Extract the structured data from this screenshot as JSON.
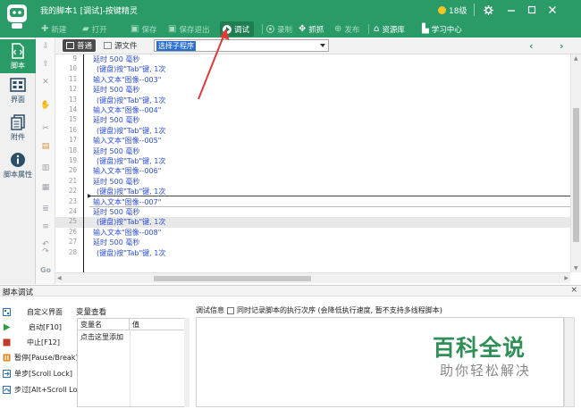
{
  "titlebar": {
    "title": "我的脚本1 [调试]-按键精灵",
    "vip_label": "18级"
  },
  "toolbar": {
    "tools": [
      {
        "label": "新建",
        "icon": "plus-icon",
        "enabled": false
      },
      {
        "label": "打开",
        "icon": "folder-open-icon",
        "enabled": false
      },
      {
        "label": "保存",
        "icon": "save-icon",
        "enabled": false
      },
      {
        "label": "保存退出",
        "icon": "save-exit-icon",
        "enabled": false
      },
      {
        "label": "调试",
        "icon": "play-icon",
        "enabled": true,
        "active": true
      },
      {
        "label": "录制",
        "icon": "record-icon",
        "enabled": false
      },
      {
        "label": "抓抓",
        "icon": "grab-icon",
        "enabled": true
      },
      {
        "label": "发布",
        "icon": "publish-icon",
        "enabled": false
      },
      {
        "label": "资源库",
        "icon": "resource-library-icon",
        "enabled": true
      },
      {
        "label": "学习中心",
        "icon": "learning-center-icon",
        "enabled": true
      }
    ]
  },
  "leftnav": {
    "items": [
      {
        "label": "脚本",
        "icon": "script-icon",
        "active": true
      },
      {
        "label": "界面",
        "icon": "interface-icon",
        "active": false
      },
      {
        "label": "附件",
        "icon": "attachment-icon",
        "active": false
      },
      {
        "label": "脚本属性",
        "icon": "info-icon",
        "active": false
      }
    ]
  },
  "editor": {
    "view_normal": "普通",
    "view_source": "源文件",
    "subroutine_select": "选择子程序",
    "lines": [
      {
        "n": "9",
        "text": "延时 500 毫秒",
        "indent": false
      },
      {
        "n": "10",
        "text": "(键盘)按\"Tab\"键, 1次",
        "indent": true
      },
      {
        "n": "11",
        "text": "输入文本\"图像--003\"",
        "indent": false
      },
      {
        "n": "12",
        "text": "延时 500 毫秒",
        "indent": false
      },
      {
        "n": "13",
        "text": "(键盘)按\"Tab\"键, 1次",
        "indent": true
      },
      {
        "n": "14",
        "text": "输入文本\"图像--004\"",
        "indent": false
      },
      {
        "n": "15",
        "text": "延时 500 毫秒",
        "indent": false
      },
      {
        "n": "16",
        "text": "(键盘)按\"Tab\"键, 1次",
        "indent": true
      },
      {
        "n": "17",
        "text": "输入文本\"图像--005\"",
        "indent": false
      },
      {
        "n": "18",
        "text": "延时 500 毫秒",
        "indent": false
      },
      {
        "n": "19",
        "text": "(键盘)按\"Tab\"键, 1次",
        "indent": true
      },
      {
        "n": "20",
        "text": "输入文本\"图像--006\"",
        "indent": false
      },
      {
        "n": "21",
        "text": "延时 500 毫秒",
        "indent": false
      },
      {
        "n": "22",
        "text": "(键盘)按\"Tab\"键, 1次",
        "indent": true
      },
      {
        "n": "23",
        "text": "输入文本\"图像--007\"",
        "indent": false
      },
      {
        "n": "24",
        "text": "延时 500 毫秒",
        "indent": false
      },
      {
        "n": "25",
        "text": "(键盘)按\"Tab\"键, 1次",
        "indent": true
      },
      {
        "n": "26",
        "text": "输入文本\"图像--008\"",
        "indent": false
      },
      {
        "n": "27",
        "text": "延时 500 毫秒",
        "indent": false
      },
      {
        "n": "28",
        "text": "(键盘)按\"Tab\"键, 1次",
        "indent": true
      }
    ]
  },
  "debug": {
    "panel_title": "脚本调试",
    "close": "×",
    "buttons": [
      {
        "label": "自定义界面",
        "icon": "custom-ui-icon",
        "color": "#2f6fb6"
      },
      {
        "label": "启动[F10]",
        "icon": "start-icon",
        "color": "#2ea043"
      },
      {
        "label": "中止[F12]",
        "icon": "stop-icon",
        "color": "#c0392b"
      },
      {
        "label": "暂停[Pause/Break]",
        "icon": "pause-icon",
        "color": "#e08a1e"
      },
      {
        "label": "单步[Scroll Lock]",
        "icon": "step-icon",
        "color": "#2f6fb6"
      },
      {
        "label": "步过[Alt+Scroll Lock]",
        "icon": "step-over-icon",
        "color": "#2f6fb6"
      }
    ],
    "var_view": "变量查看",
    "var_col_name": "变量名",
    "var_col_value": "值",
    "var_add": "点击这里添加",
    "info_label": "调试信息",
    "record_order": "同时记录脚本的执行次序 (会降低执行速度, 暂不支持多线程脚本)"
  },
  "watermark": {
    "title": "百科全说",
    "subtitle": "助你轻松解决"
  },
  "colors": {
    "brand_green": "#2a9b67",
    "code_blue": "#2c4ed6",
    "arrow_red": "#e03a3a"
  }
}
